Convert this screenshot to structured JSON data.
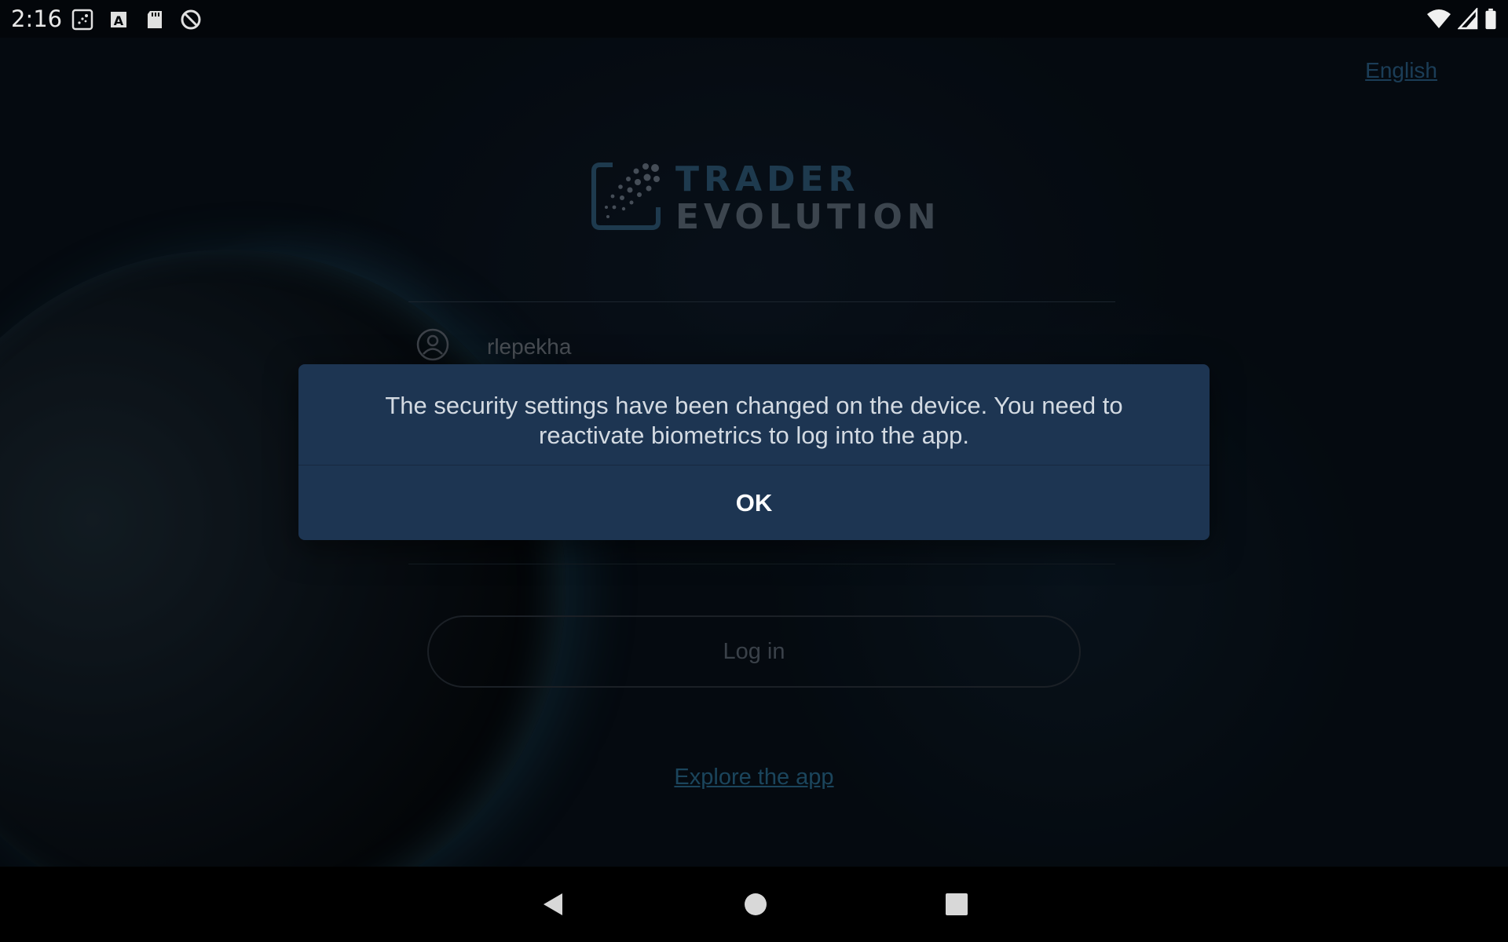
{
  "status_bar": {
    "time": "2:16",
    "left_icons": [
      "screenshot-icon",
      "font-icon",
      "sd-card-icon",
      "sync-off-icon"
    ],
    "right_icons": [
      "wifi-icon",
      "signal-icon",
      "battery-icon"
    ]
  },
  "header": {
    "language_label": "English"
  },
  "logo": {
    "line1": "TRADER",
    "line2": "EVOLUTION"
  },
  "login_form": {
    "username": "rlepekha",
    "login_button_label": "Log in",
    "explore_link_label": "Explore the app"
  },
  "dialog": {
    "message": "The security settings have been changed on the device. You need to reactivate biometrics to log into the app.",
    "ok_label": "OK"
  },
  "nav_bar": {
    "buttons": [
      "back-icon",
      "home-icon",
      "recents-icon"
    ]
  },
  "colors": {
    "dialog_background": "#1d3552",
    "accent_link": "#2a6a8e"
  }
}
